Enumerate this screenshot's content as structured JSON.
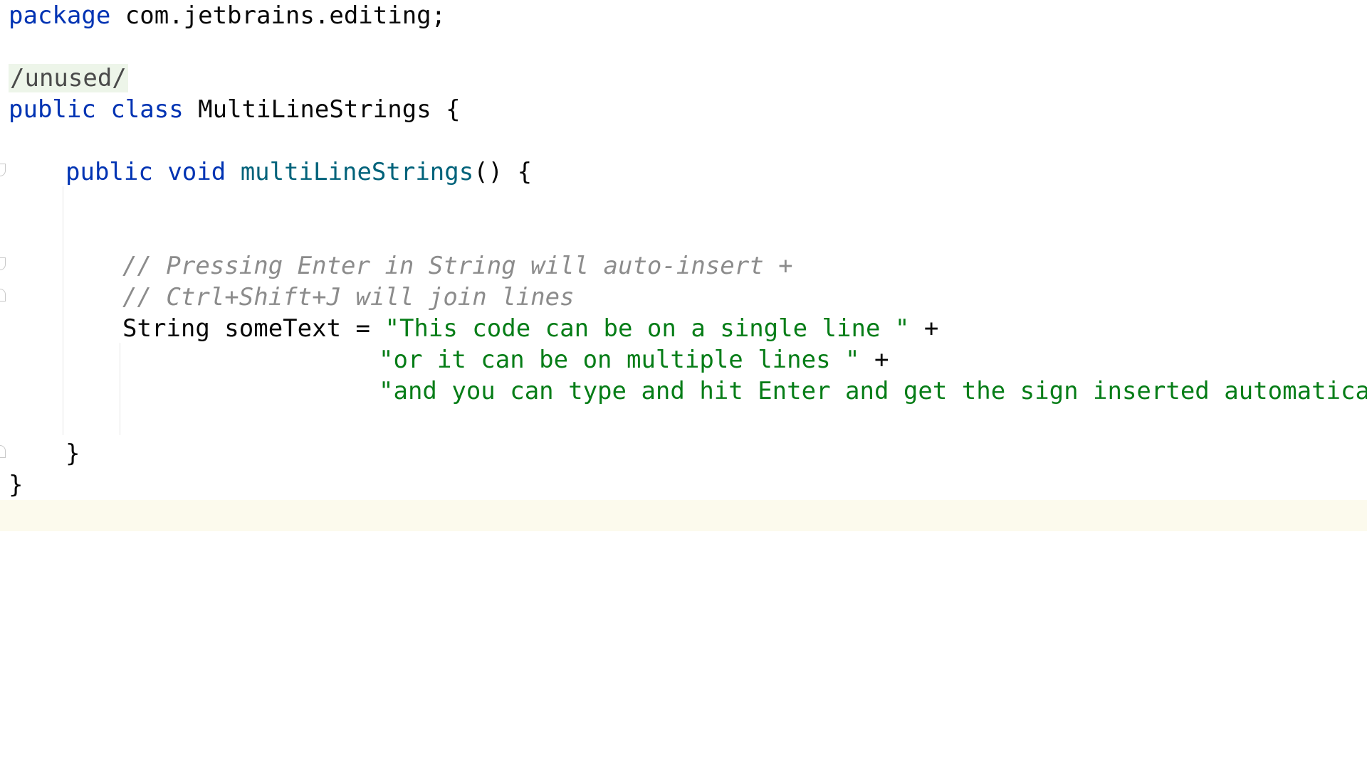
{
  "editor": {
    "lines": {
      "l1": {
        "kw": "package",
        "rest": " com.jetbrains.editing;"
      },
      "l3": {
        "ann": "/unused/"
      },
      "l4": {
        "kw1": "public",
        "kw2": "class",
        "rest": " MultiLineStrings {"
      },
      "l6": {
        "kw1": "public",
        "kw2": "void",
        "fn": "multiLineStrings",
        "rest": "() {"
      },
      "l9": {
        "cmt": "// Pressing Enter in String will auto-insert +"
      },
      "l10": {
        "cmt": "// Ctrl+Shift+J will join lines"
      },
      "l11": {
        "decl": "String someText = ",
        "str": "\"This code can be on a single line \"",
        "op": " +"
      },
      "l12": {
        "str": "\"or it can be on multiple lines \"",
        "op": " +"
      },
      "l13": {
        "str": "\"and you can type and hit Enter and get the sign inserted automatically\""
      },
      "l15": {
        "rest": "}"
      },
      "l16": {
        "rest": "}"
      }
    },
    "colors": {
      "keyword": "#0033b3",
      "method": "#00627a",
      "string": "#067d17",
      "comment": "#8c8c8c",
      "caret_row": "#fcfaed",
      "annotation_bg": "#edf5e9"
    }
  }
}
